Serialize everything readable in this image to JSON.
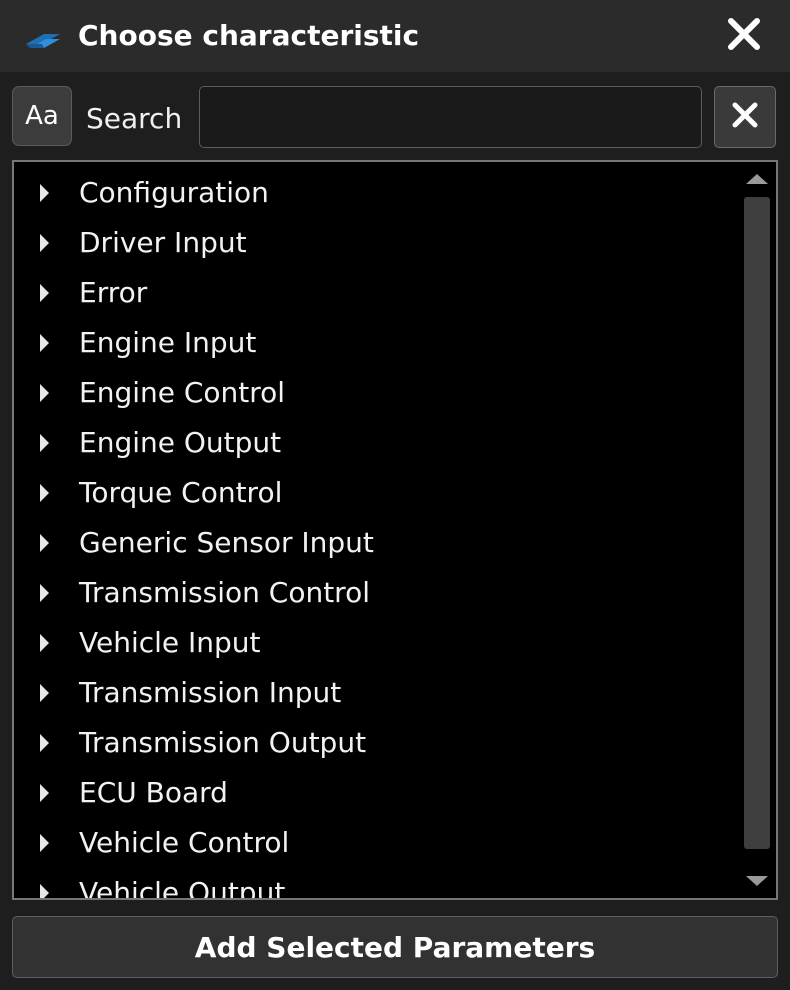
{
  "window": {
    "title": "Choose characteristic",
    "icon": "app-logo-icon",
    "close_icon": "close-icon"
  },
  "search": {
    "case_toggle_label": "Aa",
    "label": "Search",
    "value": "",
    "placeholder": "",
    "clear_icon": "close-icon"
  },
  "tree": {
    "expand_icon": "caret-right-icon",
    "items": [
      {
        "label": "Configuration"
      },
      {
        "label": "Driver Input"
      },
      {
        "label": "Error"
      },
      {
        "label": "Engine Input"
      },
      {
        "label": "Engine Control"
      },
      {
        "label": "Engine Output"
      },
      {
        "label": "Torque Control"
      },
      {
        "label": "Generic Sensor Input"
      },
      {
        "label": "Transmission Control"
      },
      {
        "label": "Vehicle Input"
      },
      {
        "label": "Transmission Input"
      },
      {
        "label": "Transmission Output"
      },
      {
        "label": "ECU Board"
      },
      {
        "label": "Vehicle Control"
      },
      {
        "label": "Vehicle Output"
      }
    ]
  },
  "footer": {
    "add_button_label": "Add Selected Parameters"
  },
  "colors": {
    "titlebar_bg": "#2b2b2b",
    "window_bg": "#1e1e1e",
    "list_bg": "#000000",
    "icon_blue": "#2f8fd8",
    "text": "#f2f2f2"
  }
}
